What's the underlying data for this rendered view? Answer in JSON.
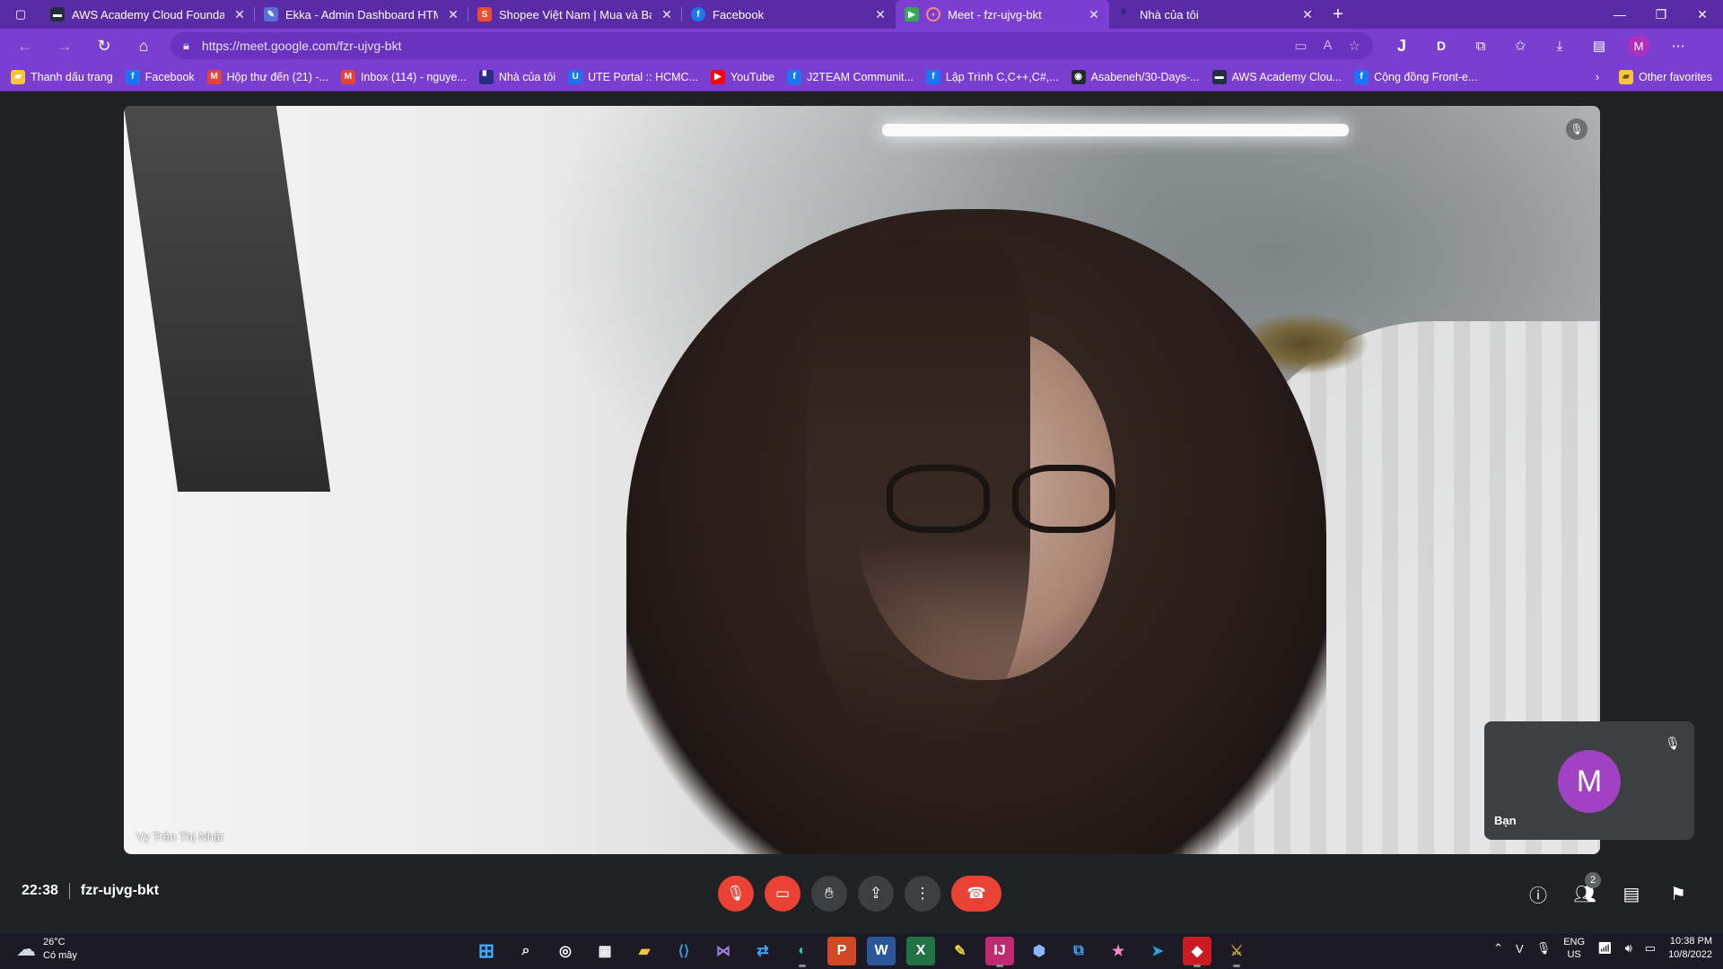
{
  "browser": {
    "tabs": [
      {
        "title": "AWS Academy Cloud Foundations",
        "fav_color": "#232f3e",
        "fav_glyph": "▬",
        "active": false
      },
      {
        "title": "Ekka - Admin Dashboard HTML",
        "fav_color": "#5b6fd6",
        "fav_glyph": "✎",
        "active": false
      },
      {
        "title": "Shopee Việt Nam | Mua và Bán Trên",
        "fav_color": "#ee4d2d",
        "fav_glyph": "S",
        "active": false
      },
      {
        "title": "Facebook",
        "fav_color": "#1877f2",
        "fav_glyph": "f",
        "active": false
      },
      {
        "title": "Meet - fzr-ujvg-bkt",
        "fav_color": "#34a853",
        "fav_glyph": "●",
        "active": true
      },
      {
        "title": "Nhà của tôi",
        "fav_color": "#2b2b8a",
        "fav_glyph": "▘",
        "active": false
      }
    ],
    "url": "https://meet.google.com/fzr-ujvg-bkt",
    "profile_initial": "M",
    "ext_j": "J",
    "ext_d": "D"
  },
  "bookmarks": {
    "items": [
      {
        "label": "Thanh dấu trang",
        "color": "#f5c542",
        "glyph": "▰"
      },
      {
        "label": "Facebook",
        "color": "#1877f2",
        "glyph": "f"
      },
      {
        "label": "Hộp thư đến (21) -...",
        "color": "#ea4335",
        "glyph": "M"
      },
      {
        "label": "Inbox (114) - nguye...",
        "color": "#ea4335",
        "glyph": "M"
      },
      {
        "label": "Nhà của tôi",
        "color": "#2b2b8a",
        "glyph": "▘"
      },
      {
        "label": "UTE Portal :: HCMC...",
        "color": "#1a73e8",
        "glyph": "U"
      },
      {
        "label": "YouTube",
        "color": "#ff0000",
        "glyph": "▶"
      },
      {
        "label": "J2TEAM Communit...",
        "color": "#1877f2",
        "glyph": "f"
      },
      {
        "label": "Lập Trình C,C++,C#,...",
        "color": "#1877f2",
        "glyph": "f"
      },
      {
        "label": "Asabeneh/30-Days-...",
        "color": "#24292f",
        "glyph": "◉"
      },
      {
        "label": "AWS Academy Clou...",
        "color": "#232f3e",
        "glyph": "▬"
      },
      {
        "label": "Cộng đồng Front-e...",
        "color": "#1877f2",
        "glyph": "f"
      }
    ],
    "other": "Other favorites"
  },
  "meet": {
    "participant_name": "Vy Trần Thị Nhật",
    "self_label": "Bạn",
    "self_initial": "M",
    "time": "22:38",
    "meeting_code": "fzr-ujvg-bkt",
    "people_count": "2"
  },
  "taskbar": {
    "temperature": "26°C",
    "weather": "Có mây",
    "lang_top": "ENG",
    "lang_bottom": "US",
    "clock_time": "10:38 PM",
    "clock_date": "10/8/2022"
  },
  "colors": {
    "browser_frame": "#7a3fd0",
    "end_call": "#ea4335",
    "avatar": "#a142c4"
  }
}
